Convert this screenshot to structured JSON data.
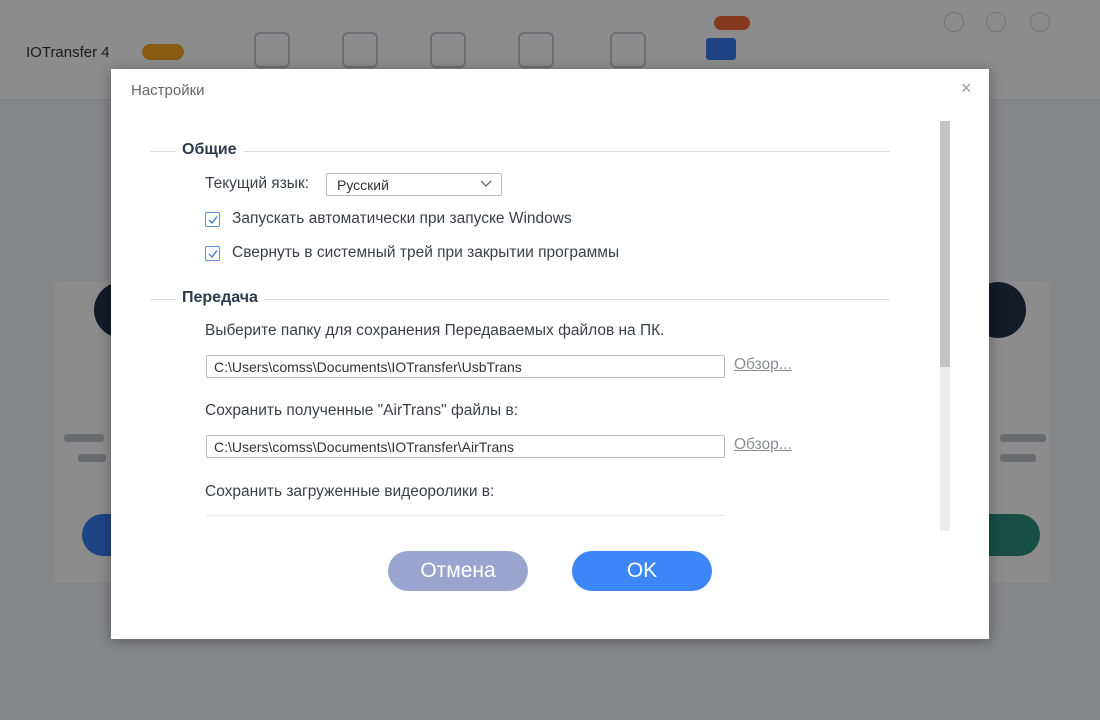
{
  "background_app": {
    "title": "IOTransfer 4"
  },
  "dialog": {
    "title": "Настройки",
    "close_glyph": "×",
    "general": {
      "heading": "Общие",
      "language_label": "Текущий язык:",
      "language_value": "Русский",
      "autostart_label": "Запускать автоматически при запуске Windows",
      "autostart_checked": true,
      "minimize_to_tray_label": "Свернуть в системный трей при закрытии программы",
      "minimize_to_tray_checked": true
    },
    "transfer": {
      "heading": "Передача",
      "save_folder_label": "Выберите папку для сохранения Передаваемых файлов на ПК.",
      "save_folder_path": "C:\\Users\\comss\\Documents\\IOTransfer\\UsbTrans",
      "airtrans_label": "Сохранить полученные \"AirTrans\" файлы в:",
      "airtrans_path": "C:\\Users\\comss\\Documents\\IOTransfer\\AirTrans",
      "videos_label": "Сохранить загруженные видеоролики в:",
      "browse_label": "Обзор..."
    },
    "buttons": {
      "cancel": "Отмена",
      "ok": "OK"
    }
  },
  "colors": {
    "accent": "#3d86f7",
    "cancel_button": "#9aa5cf",
    "checkbox_border": "#5b8fd6"
  }
}
